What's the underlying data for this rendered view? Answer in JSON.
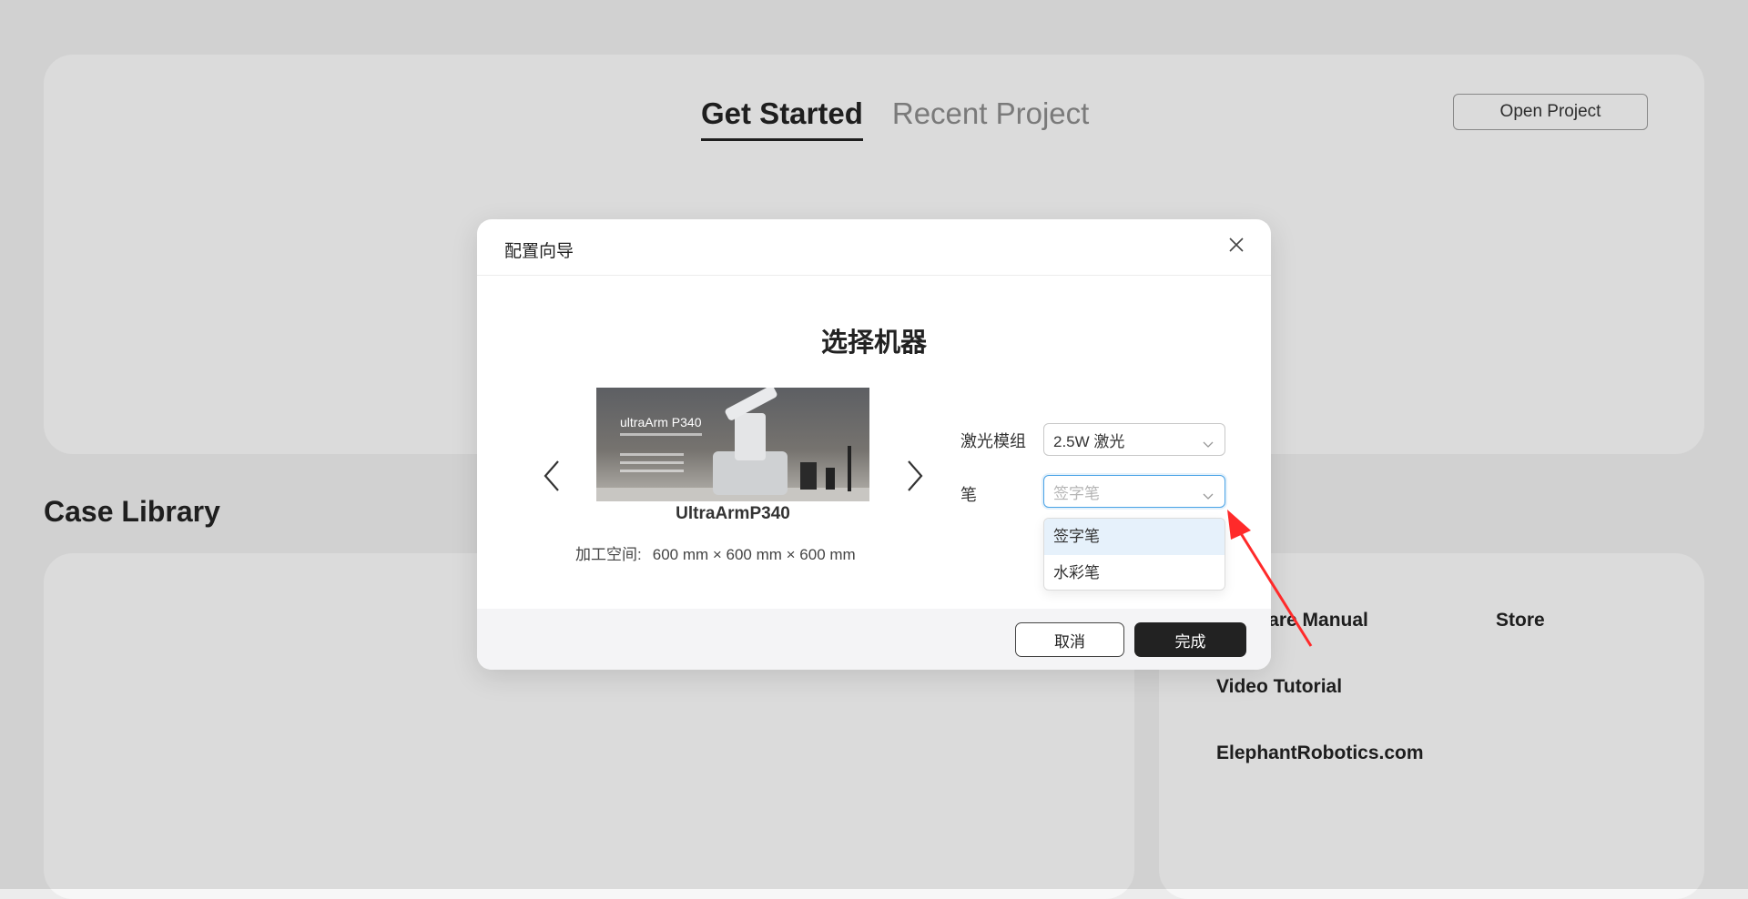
{
  "background": {
    "tabs": [
      {
        "label": "Get Started",
        "active": true
      },
      {
        "label": "Recent Project",
        "active": false
      }
    ],
    "open_project_label": "Open Project",
    "case_library_title": "Case Library",
    "links": {
      "software_manual": "Software Manual",
      "store": "Store",
      "video_tutorial": "Video Tutorial",
      "website": "ElephantRobotics.com"
    }
  },
  "dialog": {
    "title": "配置向导",
    "heading": "选择机器",
    "machine": {
      "image_caption": "ultraArm P340",
      "name": "UltraArmP340",
      "space_label": "加工空间:",
      "space_value": "600 mm × 600 mm × 600 mm"
    },
    "laser": {
      "label": "激光模组",
      "value": "2.5W 激光"
    },
    "pen": {
      "label": "笔",
      "placeholder": "签字笔",
      "options": [
        "签字笔",
        "水彩笔"
      ],
      "highlighted_option": "签字笔"
    },
    "buttons": {
      "cancel": "取消",
      "finish": "完成"
    }
  },
  "colors": {
    "accent_border": "#4aa3e6",
    "primary_button": "#222222",
    "annotation_arrow": "#ff2a2a"
  },
  "icons": [
    "close-icon",
    "chevron-left-icon",
    "chevron-right-icon",
    "chevron-down-icon"
  ]
}
